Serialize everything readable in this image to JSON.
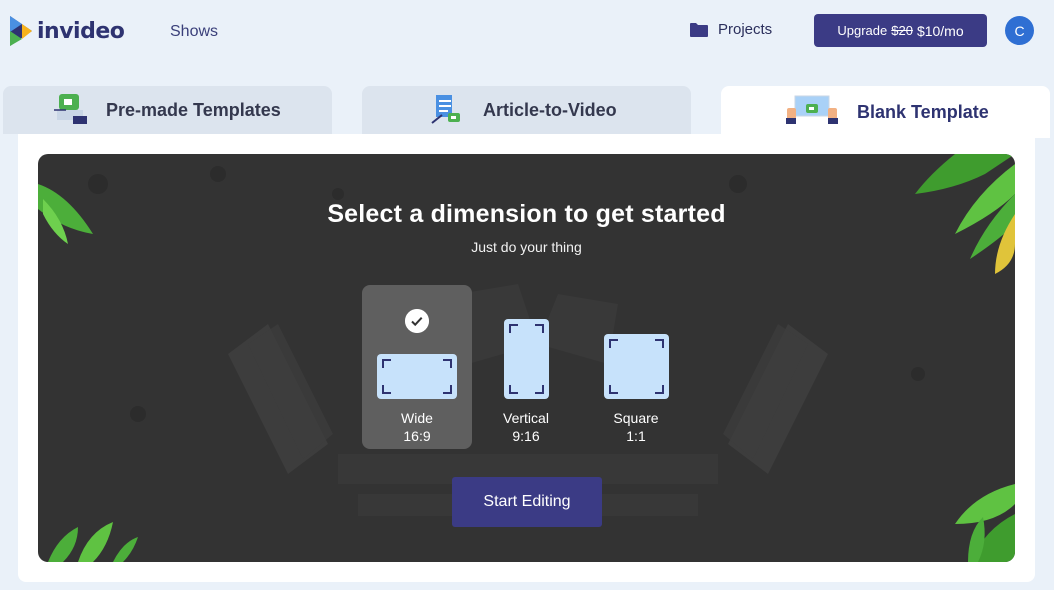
{
  "header": {
    "logo_text": "invideo",
    "nav_shows": "Shows",
    "projects_label": "Projects",
    "upgrade": {
      "label": "Upgrade",
      "old_price": "$20",
      "new_price": "$10/mo"
    },
    "avatar_initial": "C"
  },
  "tabs": [
    {
      "label": "Pre-made Templates",
      "icon": "template-card-icon",
      "active": false
    },
    {
      "label": "Article-to-Video",
      "icon": "article-video-icon",
      "active": false
    },
    {
      "label": "Blank Template",
      "icon": "blank-canvas-icon",
      "active": true
    }
  ],
  "main": {
    "title": "Select a dimension to get started",
    "subtitle": "Just do your thing",
    "dimensions": [
      {
        "name": "Wide",
        "ratio": "16:9",
        "selected": true
      },
      {
        "name": "Vertical",
        "ratio": "9:16",
        "selected": false
      },
      {
        "name": "Square",
        "ratio": "1:1",
        "selected": false
      }
    ],
    "start_button": "Start Editing"
  },
  "colors": {
    "page_bg": "#eaf1f9",
    "brand_navy": "#3b3b85",
    "stage_bg": "#333333",
    "frame_fill": "#c7e2fb",
    "avatar_bg": "#2f6fd3"
  }
}
